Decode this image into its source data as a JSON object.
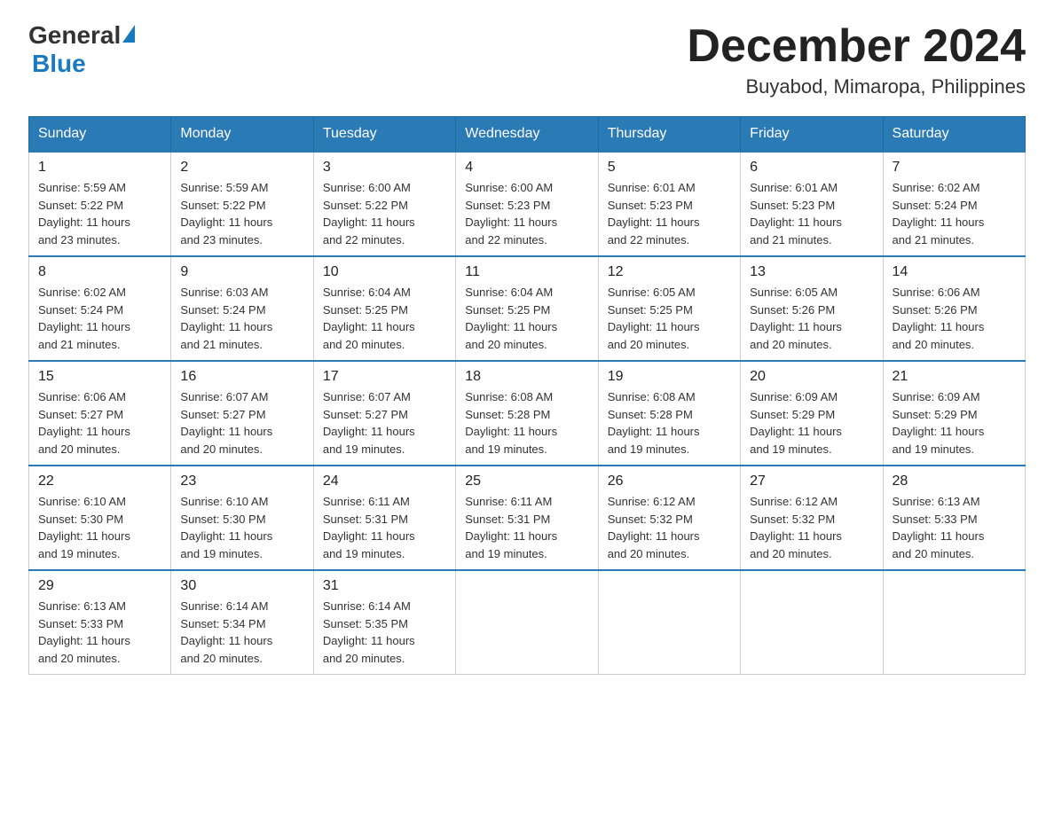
{
  "header": {
    "logo": {
      "general": "General",
      "blue": "Blue",
      "alt": "GeneralBlue logo"
    },
    "title": "December 2024",
    "location": "Buyabod, Mimaropa, Philippines"
  },
  "weekdays": [
    "Sunday",
    "Monday",
    "Tuesday",
    "Wednesday",
    "Thursday",
    "Friday",
    "Saturday"
  ],
  "weeks": [
    [
      {
        "day": "1",
        "sunrise": "5:59 AM",
        "sunset": "5:22 PM",
        "daylight": "11 hours and 23 minutes."
      },
      {
        "day": "2",
        "sunrise": "5:59 AM",
        "sunset": "5:22 PM",
        "daylight": "11 hours and 23 minutes."
      },
      {
        "day": "3",
        "sunrise": "6:00 AM",
        "sunset": "5:22 PM",
        "daylight": "11 hours and 22 minutes."
      },
      {
        "day": "4",
        "sunrise": "6:00 AM",
        "sunset": "5:23 PM",
        "daylight": "11 hours and 22 minutes."
      },
      {
        "day": "5",
        "sunrise": "6:01 AM",
        "sunset": "5:23 PM",
        "daylight": "11 hours and 22 minutes."
      },
      {
        "day": "6",
        "sunrise": "6:01 AM",
        "sunset": "5:23 PM",
        "daylight": "11 hours and 21 minutes."
      },
      {
        "day": "7",
        "sunrise": "6:02 AM",
        "sunset": "5:24 PM",
        "daylight": "11 hours and 21 minutes."
      }
    ],
    [
      {
        "day": "8",
        "sunrise": "6:02 AM",
        "sunset": "5:24 PM",
        "daylight": "11 hours and 21 minutes."
      },
      {
        "day": "9",
        "sunrise": "6:03 AM",
        "sunset": "5:24 PM",
        "daylight": "11 hours and 21 minutes."
      },
      {
        "day": "10",
        "sunrise": "6:04 AM",
        "sunset": "5:25 PM",
        "daylight": "11 hours and 20 minutes."
      },
      {
        "day": "11",
        "sunrise": "6:04 AM",
        "sunset": "5:25 PM",
        "daylight": "11 hours and 20 minutes."
      },
      {
        "day": "12",
        "sunrise": "6:05 AM",
        "sunset": "5:25 PM",
        "daylight": "11 hours and 20 minutes."
      },
      {
        "day": "13",
        "sunrise": "6:05 AM",
        "sunset": "5:26 PM",
        "daylight": "11 hours and 20 minutes."
      },
      {
        "day": "14",
        "sunrise": "6:06 AM",
        "sunset": "5:26 PM",
        "daylight": "11 hours and 20 minutes."
      }
    ],
    [
      {
        "day": "15",
        "sunrise": "6:06 AM",
        "sunset": "5:27 PM",
        "daylight": "11 hours and 20 minutes."
      },
      {
        "day": "16",
        "sunrise": "6:07 AM",
        "sunset": "5:27 PM",
        "daylight": "11 hours and 20 minutes."
      },
      {
        "day": "17",
        "sunrise": "6:07 AM",
        "sunset": "5:27 PM",
        "daylight": "11 hours and 19 minutes."
      },
      {
        "day": "18",
        "sunrise": "6:08 AM",
        "sunset": "5:28 PM",
        "daylight": "11 hours and 19 minutes."
      },
      {
        "day": "19",
        "sunrise": "6:08 AM",
        "sunset": "5:28 PM",
        "daylight": "11 hours and 19 minutes."
      },
      {
        "day": "20",
        "sunrise": "6:09 AM",
        "sunset": "5:29 PM",
        "daylight": "11 hours and 19 minutes."
      },
      {
        "day": "21",
        "sunrise": "6:09 AM",
        "sunset": "5:29 PM",
        "daylight": "11 hours and 19 minutes."
      }
    ],
    [
      {
        "day": "22",
        "sunrise": "6:10 AM",
        "sunset": "5:30 PM",
        "daylight": "11 hours and 19 minutes."
      },
      {
        "day": "23",
        "sunrise": "6:10 AM",
        "sunset": "5:30 PM",
        "daylight": "11 hours and 19 minutes."
      },
      {
        "day": "24",
        "sunrise": "6:11 AM",
        "sunset": "5:31 PM",
        "daylight": "11 hours and 19 minutes."
      },
      {
        "day": "25",
        "sunrise": "6:11 AM",
        "sunset": "5:31 PM",
        "daylight": "11 hours and 19 minutes."
      },
      {
        "day": "26",
        "sunrise": "6:12 AM",
        "sunset": "5:32 PM",
        "daylight": "11 hours and 20 minutes."
      },
      {
        "day": "27",
        "sunrise": "6:12 AM",
        "sunset": "5:32 PM",
        "daylight": "11 hours and 20 minutes."
      },
      {
        "day": "28",
        "sunrise": "6:13 AM",
        "sunset": "5:33 PM",
        "daylight": "11 hours and 20 minutes."
      }
    ],
    [
      {
        "day": "29",
        "sunrise": "6:13 AM",
        "sunset": "5:33 PM",
        "daylight": "11 hours and 20 minutes."
      },
      {
        "day": "30",
        "sunrise": "6:14 AM",
        "sunset": "5:34 PM",
        "daylight": "11 hours and 20 minutes."
      },
      {
        "day": "31",
        "sunrise": "6:14 AM",
        "sunset": "5:35 PM",
        "daylight": "11 hours and 20 minutes."
      },
      null,
      null,
      null,
      null
    ]
  ],
  "labels": {
    "sunrise": "Sunrise:",
    "sunset": "Sunset:",
    "daylight": "Daylight:"
  }
}
